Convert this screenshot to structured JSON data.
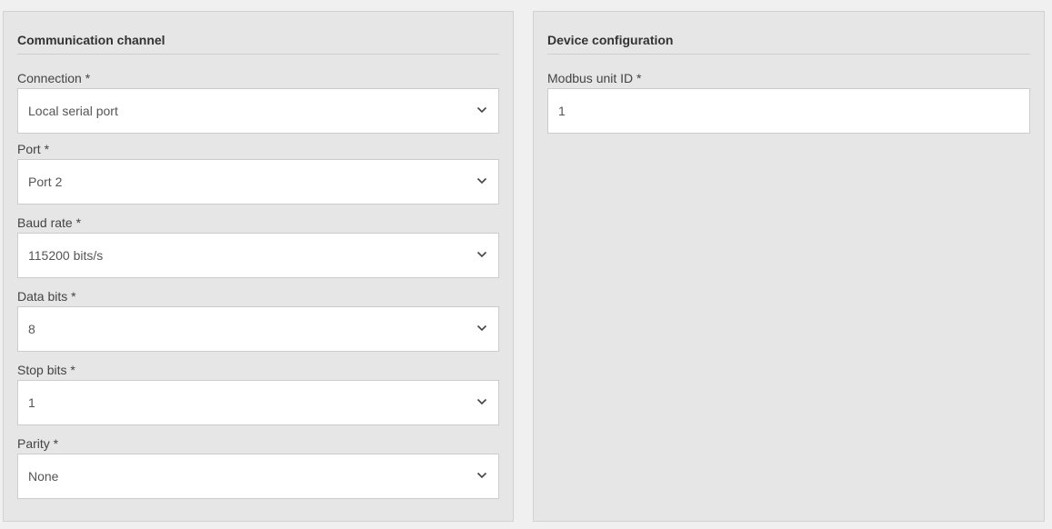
{
  "communication": {
    "title": "Communication channel",
    "fields": [
      {
        "label": "Connection *",
        "value": "Local serial port"
      },
      {
        "label": "Port *",
        "value": "Port 2"
      },
      {
        "label": "Baud rate *",
        "value": "115200 bits/s"
      },
      {
        "label": "Data bits *",
        "value": "8"
      },
      {
        "label": "Stop bits *",
        "value": "1"
      },
      {
        "label": "Parity *",
        "value": "None"
      }
    ]
  },
  "device": {
    "title": "Device configuration",
    "fields": [
      {
        "label": "Modbus unit ID *",
        "value": "1"
      }
    ]
  },
  "icons": {
    "dropdown": "chevron-down-icon"
  }
}
